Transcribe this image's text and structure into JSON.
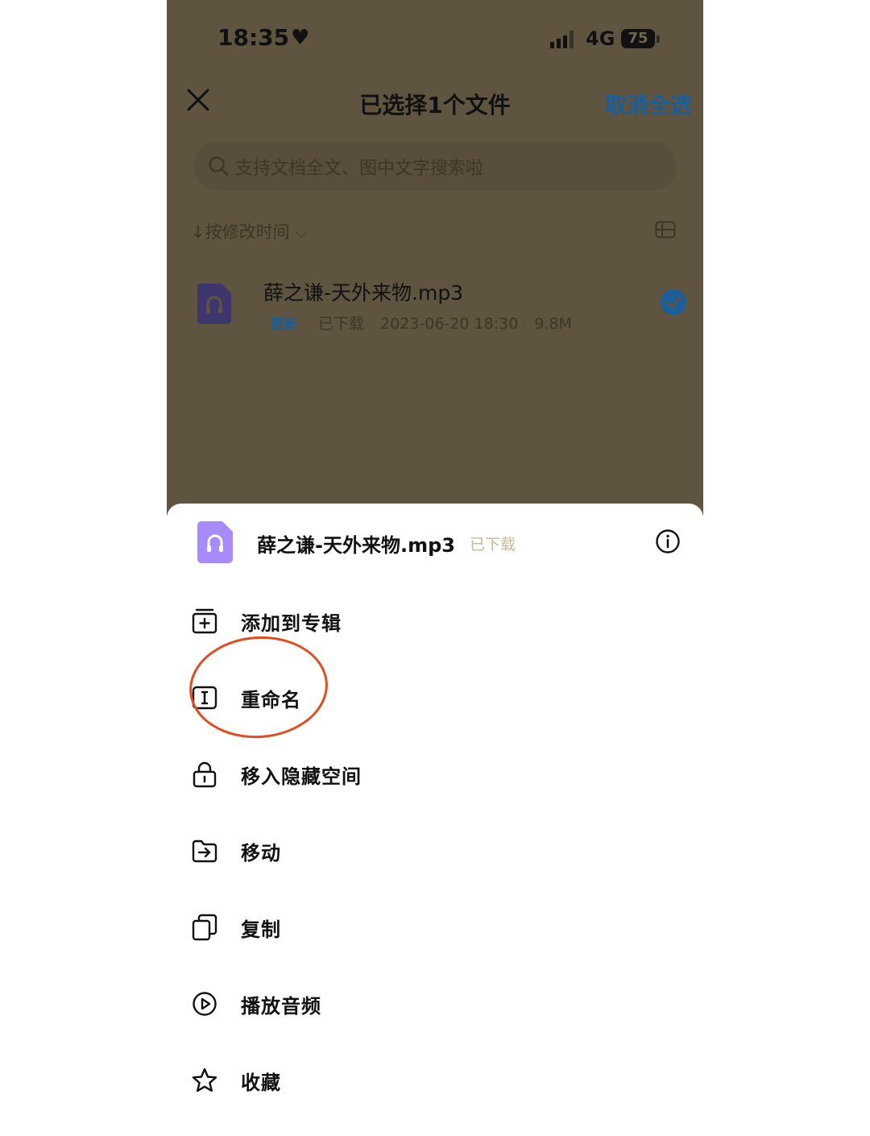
{
  "status_bar": {
    "time": "18:35",
    "network": "4G",
    "battery": "75"
  },
  "nav": {
    "title": "已选择1个文件",
    "cancel_all": "取消全选"
  },
  "search": {
    "placeholder": "支持文档全文、图中文字搜索啦"
  },
  "sort": {
    "label": "↓按修改时间 ⌵"
  },
  "file": {
    "name": "薛之谦-天外来物.mp3",
    "badge": "更新",
    "status": "已下载",
    "date": "2023-06-20 18:30",
    "size": "9.8M",
    "selected": true
  },
  "sheet": {
    "file_name": "薛之谦-天外来物.mp3",
    "file_status": "已下载",
    "items": [
      {
        "label": "添加到专辑",
        "icon": "add-to-album-icon"
      },
      {
        "label": "重命名",
        "icon": "rename-icon"
      },
      {
        "label": "移入隐藏空间",
        "icon": "lock-icon"
      },
      {
        "label": "移动",
        "icon": "move-folder-icon"
      },
      {
        "label": "复制",
        "icon": "copy-icon"
      },
      {
        "label": "播放音频",
        "icon": "play-icon"
      },
      {
        "label": "收藏",
        "icon": "star-icon"
      }
    ]
  },
  "colors": {
    "accent": "#1a5e9a",
    "overlay": "#5f543f",
    "audio_icon": "#a78bfa",
    "annotation": "#e34b21"
  }
}
